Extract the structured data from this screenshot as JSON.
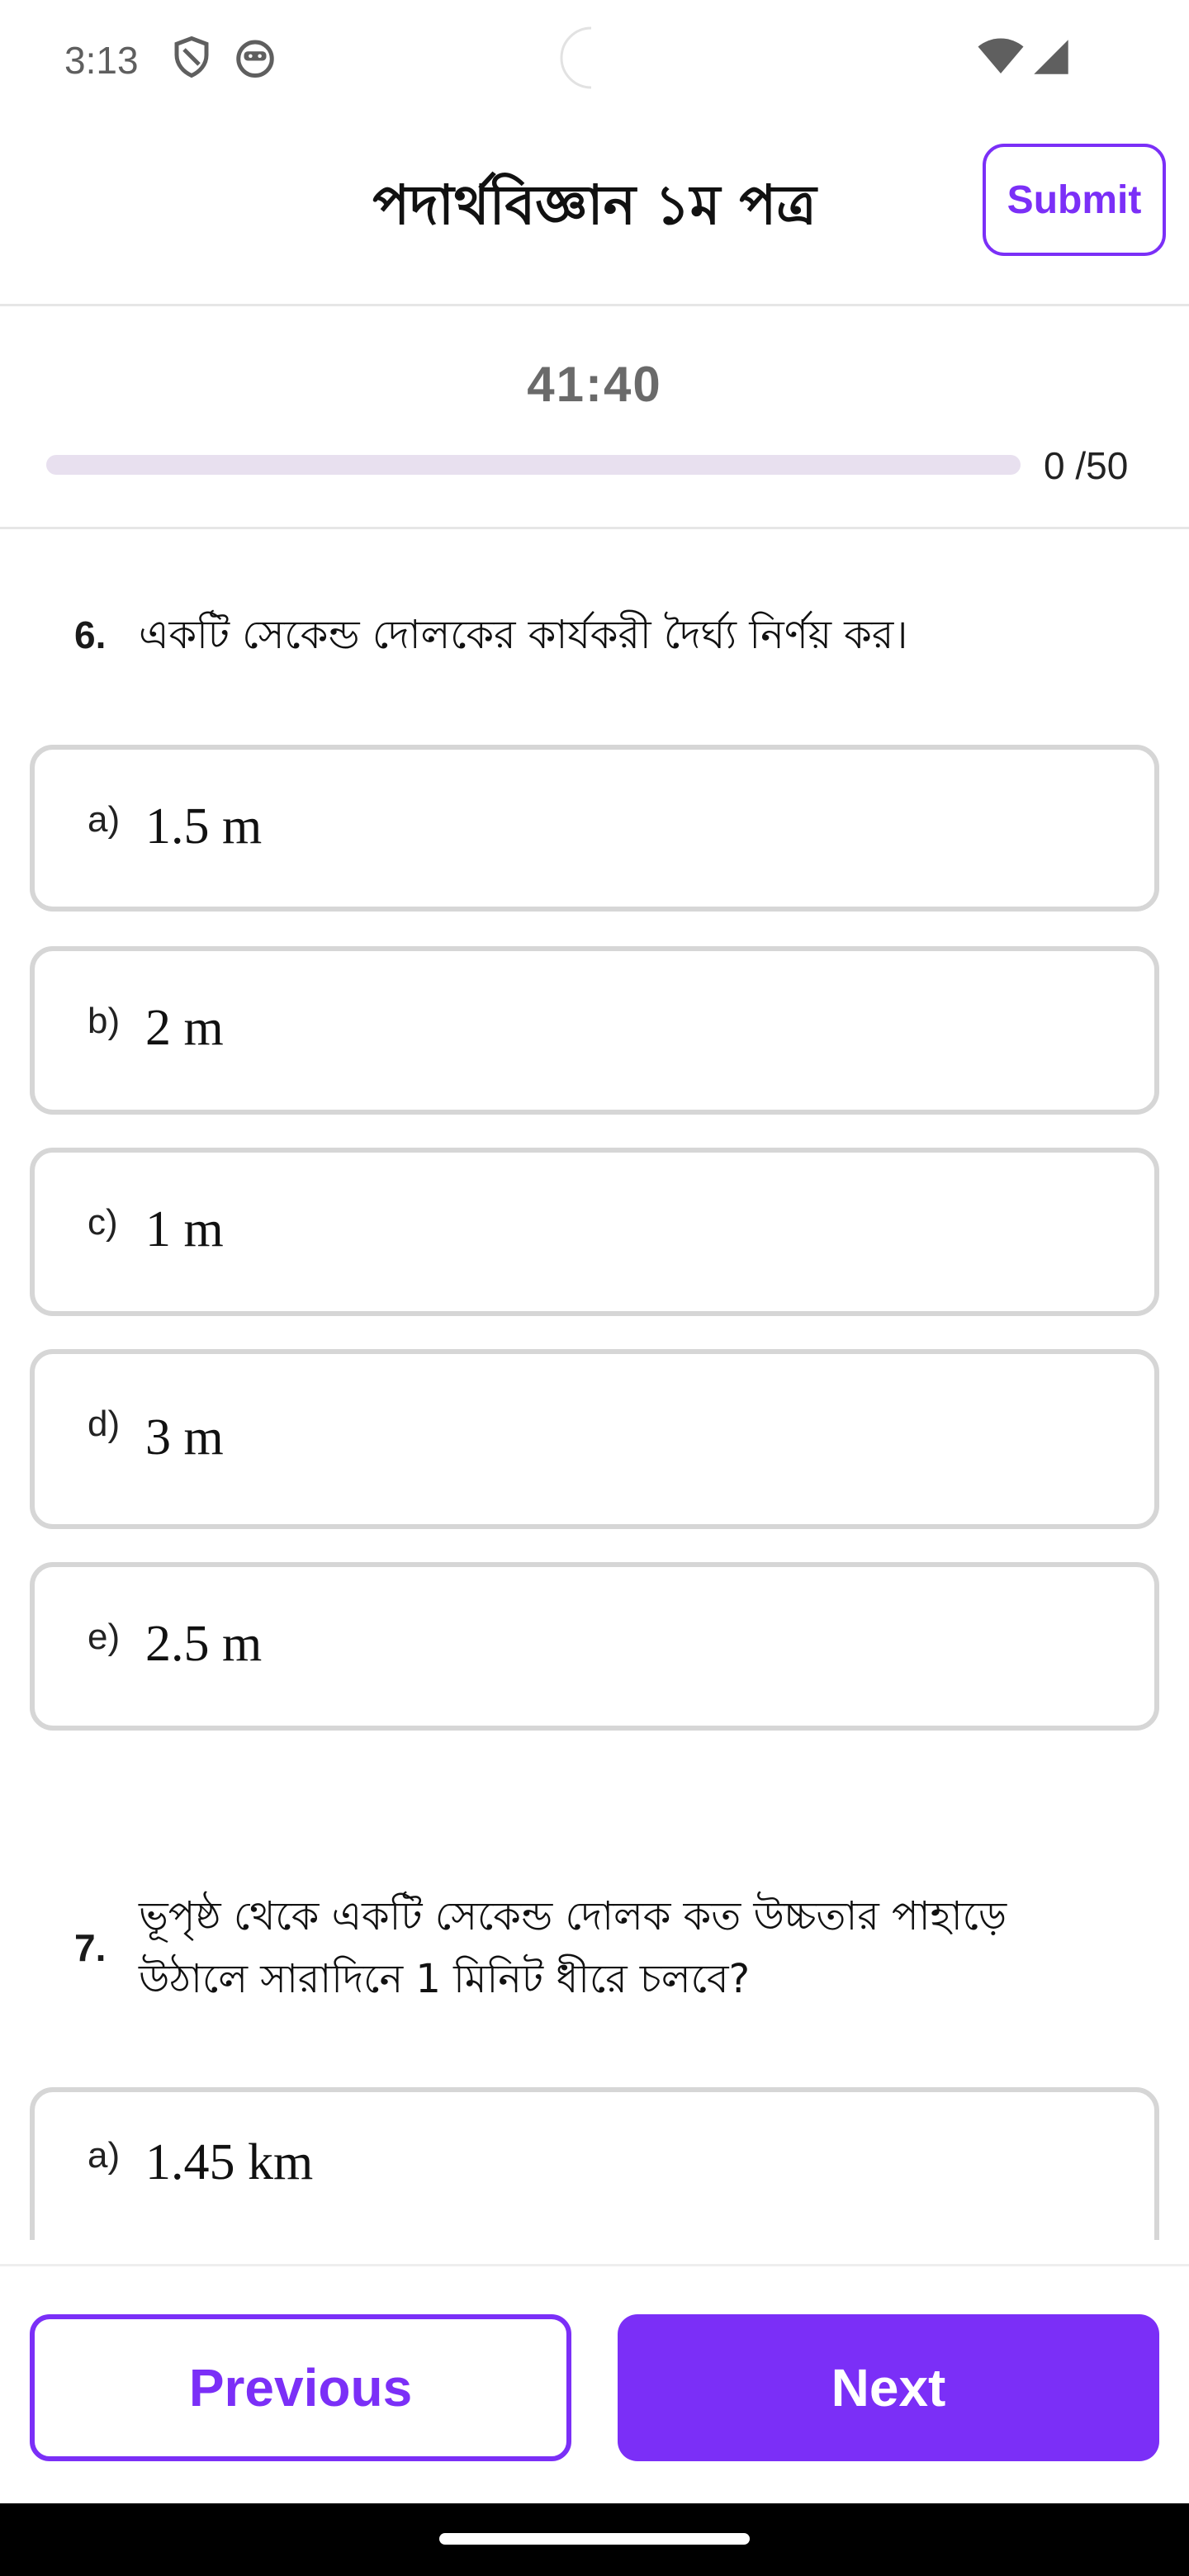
{
  "status_bar": {
    "time": "3:13",
    "icons": [
      "shield-icon",
      "robot-face-icon",
      "wifi-icon",
      "cellular-signal-icon"
    ]
  },
  "header": {
    "title": "পদার্থবিজ্ঞান ১ম পত্র",
    "submit_label": "Submit"
  },
  "timer": {
    "remaining": "41:40",
    "progress_text": "0 /50",
    "answered": 0,
    "total": 50
  },
  "questions": [
    {
      "number": "6.",
      "text": "একটি সেকেন্ড দোলকের কার্যকরী দৈর্ঘ্য নির্ণয় কর।",
      "options": [
        {
          "letter": "a)",
          "text": "1.5 m"
        },
        {
          "letter": "b)",
          "text": "2 m"
        },
        {
          "letter": "c)",
          "text": "1 m"
        },
        {
          "letter": "d)",
          "text": "3 m"
        },
        {
          "letter": "e)",
          "text": "2.5 m"
        }
      ]
    },
    {
      "number": "7.",
      "text_line1": "ভূপৃষ্ঠ থেকে একটি সেকেন্ড দোলক কত উচ্চতার পাহাড়ে",
      "text_line2": "উঠালে সারাদিনে 1 মিনিট ধীরে চলবে?",
      "options": [
        {
          "letter": "a)",
          "text": "1.45 km"
        }
      ]
    }
  ],
  "navigation": {
    "previous_label": "Previous",
    "next_label": "Next"
  },
  "colors": {
    "accent": "#7b2ff7",
    "option_border": "#d6d6d6",
    "progress_track": "#e8e0ef"
  }
}
